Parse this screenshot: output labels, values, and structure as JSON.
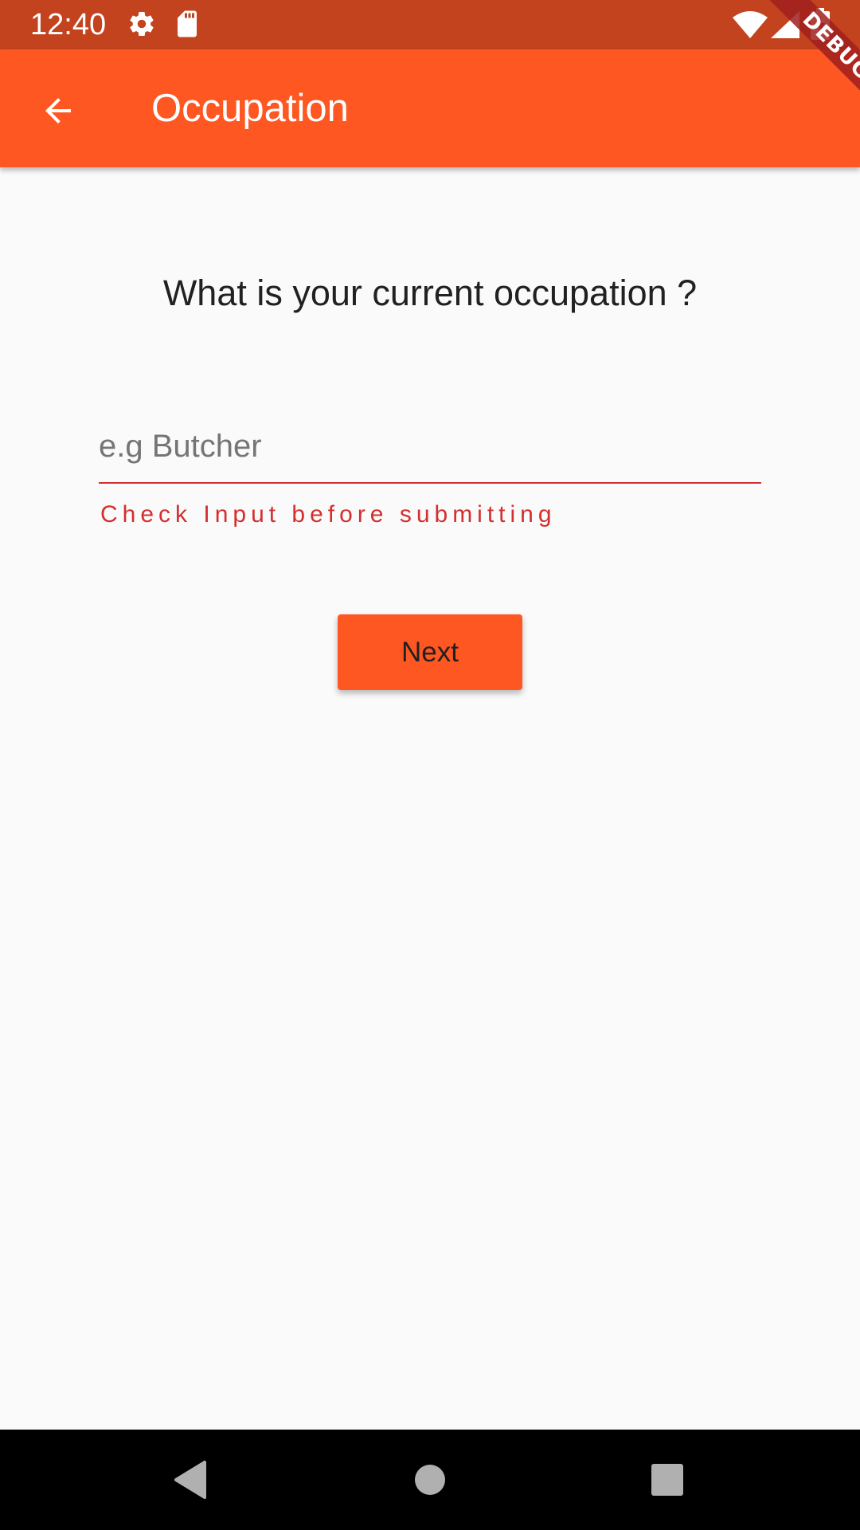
{
  "status_bar": {
    "time": "12:40",
    "icons": [
      "settings-icon",
      "sd-card-icon",
      "wifi-icon",
      "signal-icon",
      "battery-charging-icon"
    ]
  },
  "app_bar": {
    "title": "Occupation",
    "back_icon": "arrow-back-icon",
    "background_color": "#ff5722"
  },
  "debug_banner": {
    "label": "DEBUG"
  },
  "form": {
    "question": "What is your current occupation ?",
    "input_placeholder": "e.g Butcher",
    "input_value": "",
    "error_text": "Check Input before submitting",
    "error_color": "#d32f2f",
    "next_label": "Next"
  },
  "nav_bar": {
    "buttons": [
      "back-triangle-icon",
      "home-circle-icon",
      "recents-square-icon"
    ]
  }
}
